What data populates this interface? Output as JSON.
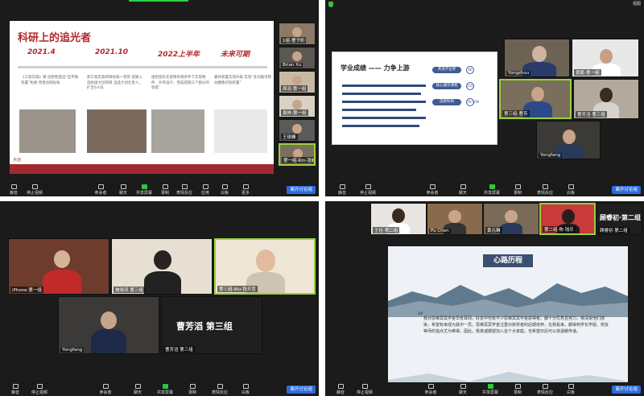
{
  "q1": {
    "slide": {
      "title": "科研上的追光者",
      "timeline": [
        "2021.4",
        "2021.10",
        "2022上半年",
        "未来可期"
      ],
      "descs": [
        "《工程实践》课 创新性提出“自平衡装置”构想 完善台院标私",
        "获工程实践项目校级一等奖 成果入选校级大创项目 当选大创负责人，扩至6人队",
        "组织团队在疫情有限条件下实现物件、外壳设计、完成后期三个部分的装配",
        "嘉并装置实现升级 实现“多功能可移动摄像识别装置”"
      ],
      "tag": "大创"
    },
    "participants": [
      "1组-曹子昕",
      "Brian Xu",
      "周润·第一组",
      "袁林-第一组",
      "王锐峰",
      "第一组-Km-张峻宸"
    ],
    "toolbar": [
      "静音",
      "停止视频",
      "参会者",
      "聊天",
      "共享屏幕",
      "录制",
      "表情反应",
      "应用",
      "白板",
      "更多"
    ],
    "end_label": "离开讨论组"
  },
  "q2": {
    "slide": {
      "title": "学业成绩 —— 力争上游",
      "pills": [
        "英语学业奖",
        "核心通识课程",
        "选修科目"
      ],
      "dots": [
        "86",
        "5/50",
        "78.5/96"
      ]
    },
    "participants": [
      "Yongzhou",
      "黄懿-第一组",
      "第三组-曹芳",
      "曹芳滔·第三组",
      "Yongfang"
    ],
    "view_label": "视图",
    "toolbar": [
      "静音",
      "停止视频",
      "参会者",
      "聊天",
      "共享屏幕",
      "录制",
      "表情反应",
      "白板"
    ],
    "end_label": "离开讨论组"
  },
  "q3": {
    "participants": [
      "iPhone·第一组",
      "施晓凤 第三组",
      "第三组-Wu-钱芳宽",
      "Yongfang",
      "曹芳滔 第三组"
    ],
    "name_card": "曹芳滔 第三组",
    "toolbar": [
      "静音",
      "停止视频",
      "参会者",
      "聊天",
      "共享屏幕",
      "录制",
      "表情反应",
      "白板"
    ],
    "end_label": "离开讨论组"
  },
  "q4": {
    "participants": [
      "王佳·第二组",
      "Pu Chen",
      "黄元琳",
      "第二组-陈·钱乐"
    ],
    "group_title": "顾睿初·第二组",
    "group_name": "顾睿初·第二组",
    "slide": {
      "banner": "心路历程",
      "para": "我对思维冥冥学金早有耳闻，好友中也有不少思维冥冥学金获得者。都十分优秀且努力，我深受他们感染，希望有幸成为其中一员。思维冥冥学金注重对获奖者的后期培养，在我看来，都得到学长学姐、校友等师的指点尤为难得，因此，我真诚期望加入这个大家庭，也希望日后可以将温暖传递。"
    },
    "toolbar": [
      "静音",
      "停止视频",
      "参会者",
      "聊天",
      "共享屏幕",
      "录制",
      "表情反应",
      "白板"
    ],
    "end_label": "离开讨论组"
  }
}
